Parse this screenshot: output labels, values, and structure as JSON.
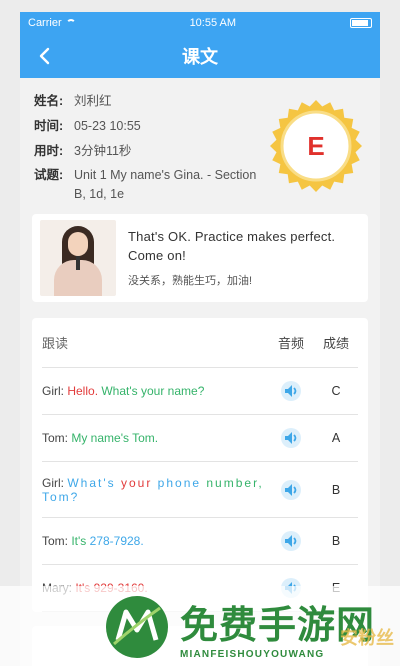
{
  "status_bar": {
    "carrier": "Carrier",
    "time": "10:55 AM"
  },
  "nav": {
    "title": "课文"
  },
  "info": {
    "name_label": "姓名:",
    "name_value": "刘利红",
    "time_label": "时间:",
    "time_value": "05-23 10:55",
    "duration_label": "用时:",
    "duration_value": "3分钟11秒",
    "topic_label": "试题:",
    "topic_value": "Unit 1 My name's Gina. - Section B, 1d, 1e",
    "grade": "E"
  },
  "feedback": {
    "en": "That's OK. Practice makes perfect. Come on!",
    "cn": "没关系，熟能生巧，加油!"
  },
  "table": {
    "headers": {
      "text": "跟读",
      "audio": "音频",
      "score": "成绩"
    },
    "rows": [
      {
        "speaker": "Girl:",
        "segments": [
          {
            "text": "Hello.",
            "color": "red"
          },
          {
            "text": "What's your name?",
            "color": "green"
          }
        ],
        "score": "C"
      },
      {
        "speaker": "Tom:",
        "segments": [
          {
            "text": "My name's Tom.",
            "color": "green"
          }
        ],
        "score": "A"
      },
      {
        "speaker": "Girl:",
        "segments": [
          {
            "text": "What's",
            "color": "blue"
          },
          {
            "text": "your",
            "color": "red"
          },
          {
            "text": "phone",
            "color": "blue"
          },
          {
            "text": "number,",
            "color": "green"
          },
          {
            "text": "Tom?",
            "color": "blue"
          }
        ],
        "score": "B"
      },
      {
        "speaker": "Tom:",
        "segments": [
          {
            "text": "It's",
            "color": "green"
          },
          {
            "text": "278-7928.",
            "color": "blue"
          }
        ],
        "score": "B"
      },
      {
        "speaker": "Mary:",
        "segments": [
          {
            "text": "It's 929-3160.",
            "color": "red"
          }
        ],
        "score": "E"
      }
    ]
  },
  "watermark": {
    "cn": "免费手游网",
    "en": "MIANFEISHOUYOUWANG",
    "tag": "安粉丝"
  },
  "colors": {
    "accent": "#3da4f2",
    "green": "#35b36a",
    "red": "#e23b3b",
    "blue": "#3ea7e8",
    "badge": "#f5c542"
  },
  "icons": {
    "back": "chevron-left-icon",
    "audio": "speaker-icon"
  }
}
